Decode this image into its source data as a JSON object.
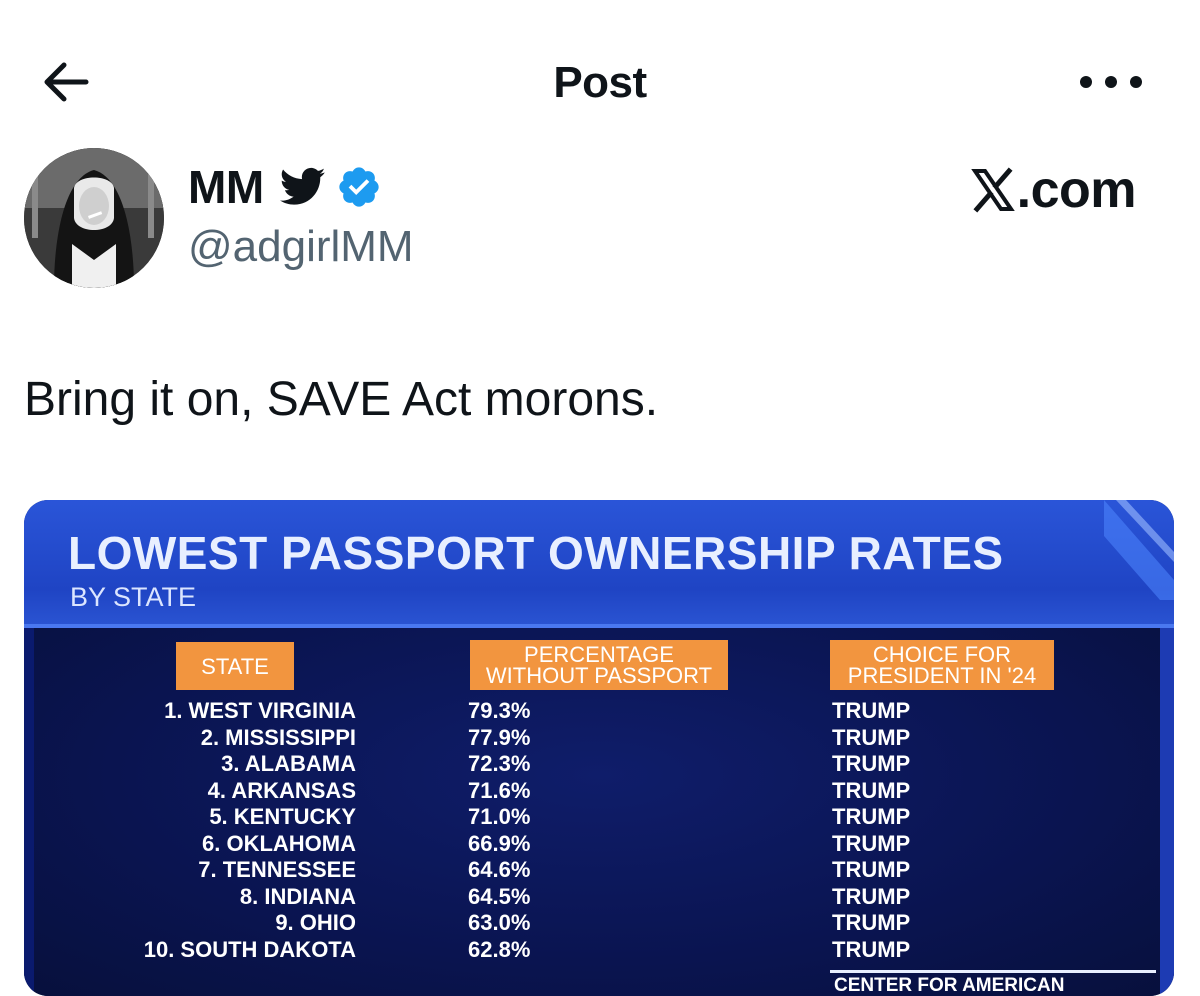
{
  "header": {
    "title": "Post"
  },
  "author": {
    "name": "MM",
    "handle": "@adgirlMM"
  },
  "brand": {
    "text": ".com"
  },
  "post": {
    "text": "Bring it on, SAVE Act morons."
  },
  "media": {
    "title": "LOWEST PASSPORT OWNERSHIP RATES",
    "subtitle": "BY STATE",
    "columns": {
      "state": "STATE",
      "pct_line1": "PERCENTAGE",
      "pct_line2": "WITHOUT PASSPORT",
      "choice_line1": "CHOICE FOR",
      "choice_line2": "PRESIDENT IN '24"
    },
    "rows": [
      {
        "state": "1. WEST VIRGINIA",
        "pct": "79.3%",
        "choice": "TRUMP"
      },
      {
        "state": "2. MISSISSIPPI",
        "pct": "77.9%",
        "choice": "TRUMP"
      },
      {
        "state": "3. ALABAMA",
        "pct": "72.3%",
        "choice": "TRUMP"
      },
      {
        "state": "4. ARKANSAS",
        "pct": "71.6%",
        "choice": "TRUMP"
      },
      {
        "state": "5. KENTUCKY",
        "pct": "71.0%",
        "choice": "TRUMP"
      },
      {
        "state": "6. OKLAHOMA",
        "pct": "66.9%",
        "choice": "TRUMP"
      },
      {
        "state": "7. TENNESSEE",
        "pct": "64.6%",
        "choice": "TRUMP"
      },
      {
        "state": "8. INDIANA",
        "pct": "64.5%",
        "choice": "TRUMP"
      },
      {
        "state": "9. OHIO",
        "pct": "63.0%",
        "choice": "TRUMP"
      },
      {
        "state": "10. SOUTH DAKOTA",
        "pct": "62.8%",
        "choice": "TRUMP"
      }
    ],
    "source": "CENTER FOR AMERICAN PROGRESS"
  },
  "icons": {
    "back": "arrow-left-icon",
    "more": "more-horizontal-icon",
    "bird": "twitter-bird-icon",
    "verified": "verified-badge-icon",
    "brand_mark": "x-logo-icon"
  },
  "colors": {
    "text": "#0f1419",
    "secondary_text": "#536471",
    "verified": "#1d9bf0",
    "chart_header": "#f2953f",
    "chart_blue": "#1f44c4",
    "chart_navy": "#0a1450"
  }
}
